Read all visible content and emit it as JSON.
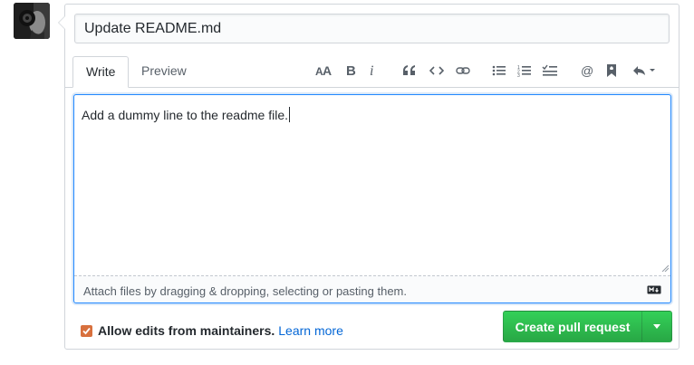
{
  "title_input": {
    "value": "Update README.md"
  },
  "tabs": [
    {
      "label": "Write"
    },
    {
      "label": "Preview"
    }
  ],
  "toolbar": {
    "icons": [
      "text-size-icon",
      "bold-icon",
      "italic-icon",
      "quote-icon",
      "code-icon",
      "link-icon",
      "unordered-list-icon",
      "ordered-list-icon",
      "task-list-icon",
      "mention-icon",
      "bookmark-icon",
      "reply-icon"
    ]
  },
  "editor": {
    "value": "Add a dummy line to the readme file."
  },
  "attach": {
    "text": "Attach files by dragging & dropping, selecting or pasting them."
  },
  "footer": {
    "allow_edits_label": "Allow edits from maintainers.",
    "learn_more": "Learn more",
    "checked": true
  },
  "submit": {
    "label": "Create pull request"
  },
  "colors": {
    "accent": "#0366d6",
    "submit_green": "#28a745",
    "checkbox": "#d8703d"
  }
}
